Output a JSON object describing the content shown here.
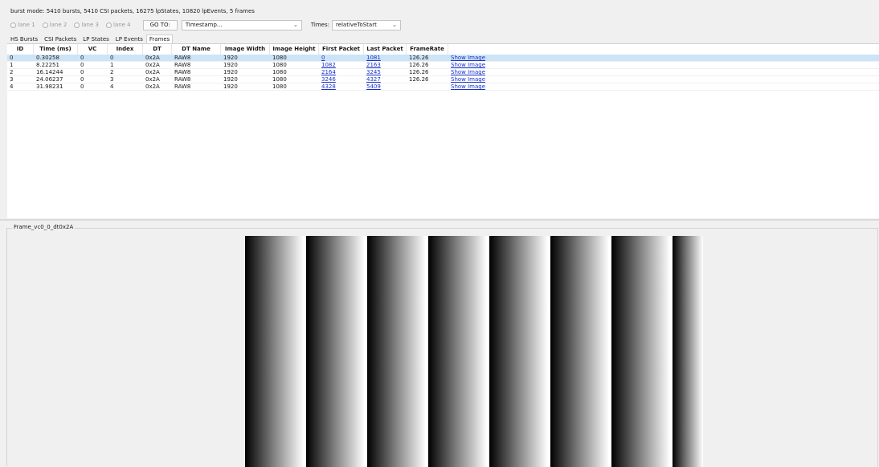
{
  "status_text": "burst mode: 5410 bursts, 5410 CSI packets, 16275 lpStates, 10820 lpEvents, 5 frames",
  "lanes": [
    "lane 1",
    "lane 2",
    "lane 3",
    "lane 4"
  ],
  "goto_button": "GO TO:",
  "goto_combo": "Timestamp...",
  "times_label": "Times:",
  "times_value": "relativeToStart",
  "tabs": [
    "HS Bursts",
    "CSI Packets",
    "LP States",
    "LP Events",
    "Frames"
  ],
  "active_tab": "Frames",
  "table": {
    "headers": [
      "ID",
      "Time (ms)",
      "VC",
      "Index",
      "DT",
      "DT Name",
      "Image Width",
      "Image Height",
      "First Packet",
      "Last Packet",
      "FrameRate"
    ],
    "rows": [
      [
        "0",
        "0.30258",
        "0",
        "0",
        "0x2A",
        "RAW8",
        "1920",
        "1080",
        "0",
        "1081",
        "126.26",
        "Show Image"
      ],
      [
        "1",
        "8.22251",
        "0",
        "1",
        "0x2A",
        "RAW8",
        "1920",
        "1080",
        "1082",
        "2163",
        "126.26",
        "Show Image"
      ],
      [
        "2",
        "16.14244",
        "0",
        "2",
        "0x2A",
        "RAW8",
        "1920",
        "1080",
        "2164",
        "3245",
        "126.26",
        "Show Image"
      ],
      [
        "3",
        "24.06237",
        "0",
        "3",
        "0x2A",
        "RAW8",
        "1920",
        "1080",
        "3246",
        "4327",
        "126.26",
        "Show Image"
      ],
      [
        "4",
        "31.98231",
        "0",
        "4",
        "0x2A",
        "RAW8",
        "1920",
        "1080",
        "4328",
        "5409",
        "",
        "Show Image"
      ]
    ],
    "selected_row": 0
  },
  "frame_title": "Frame_vc0_0_dt0x2A",
  "colors": {
    "selection": "#cce4f7",
    "link": "#1a33cc"
  }
}
